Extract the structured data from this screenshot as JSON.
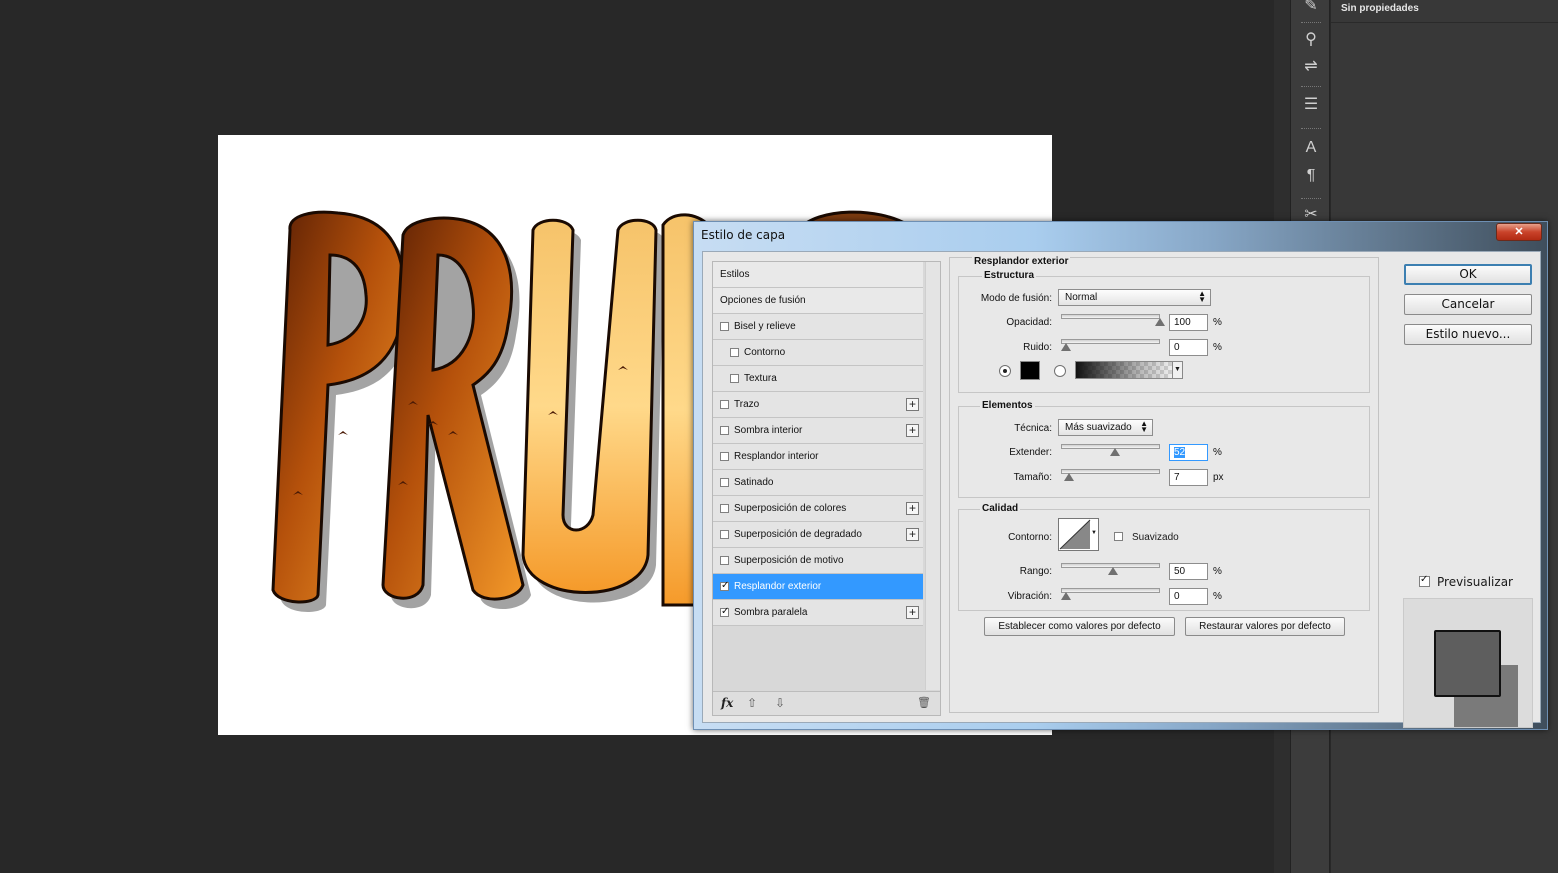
{
  "app": {
    "properties_panel_title": "Sin propiedades",
    "canvas_text": "PRUEBA"
  },
  "dialog": {
    "title": "Estilo de capa",
    "close_label": "✕",
    "styles_list": [
      {
        "label": "Estilos",
        "type": "header"
      },
      {
        "label": "Opciones de fusión",
        "type": "header"
      },
      {
        "label": "Bisel y relieve",
        "checked": false,
        "indent": false,
        "plus": false
      },
      {
        "label": "Contorno",
        "checked": false,
        "indent": true,
        "plus": false
      },
      {
        "label": "Textura",
        "checked": false,
        "indent": true,
        "plus": false
      },
      {
        "label": "Trazo",
        "checked": false,
        "indent": false,
        "plus": true
      },
      {
        "label": "Sombra interior",
        "checked": false,
        "indent": false,
        "plus": true
      },
      {
        "label": "Resplandor interior",
        "checked": false,
        "indent": false,
        "plus": false
      },
      {
        "label": "Satinado",
        "checked": false,
        "indent": false,
        "plus": false
      },
      {
        "label": "Superposición de colores",
        "checked": false,
        "indent": false,
        "plus": true
      },
      {
        "label": "Superposición de degradado",
        "checked": false,
        "indent": false,
        "plus": true
      },
      {
        "label": "Superposición de motivo",
        "checked": false,
        "indent": false,
        "plus": false
      },
      {
        "label": "Resplandor exterior",
        "checked": true,
        "indent": false,
        "plus": false,
        "selected": true
      },
      {
        "label": "Sombra paralela",
        "checked": true,
        "indent": false,
        "plus": true
      }
    ],
    "footer": {
      "fx": "fx",
      "up": "⇧",
      "down": "⇩",
      "trash": "🗑"
    },
    "panel_title": "Resplandor exterior",
    "estructura": {
      "title": "Estructura",
      "blend_mode_label": "Modo de fusión:",
      "blend_mode_value": "Normal",
      "opacity_label": "Opacidad:",
      "opacity_value": "100",
      "opacity_unit": "%",
      "opacity_level": 1.0,
      "noise_label": "Ruido:",
      "noise_value": "0",
      "noise_unit": "%",
      "noise_level": 0.0,
      "color_swatch": "#000000"
    },
    "elementos": {
      "title": "Elementos",
      "technique_label": "Técnica:",
      "technique_value": "Más suavizado",
      "spread_label": "Extender:",
      "spread_value": "52",
      "spread_unit": "%",
      "spread_level": 0.52,
      "size_label": "Tamaño:",
      "size_value": "7",
      "size_unit": "px",
      "size_level": 0.03
    },
    "calidad": {
      "title": "Calidad",
      "contour_label": "Contorno:",
      "antialias_label": "Suavizado",
      "antialias_checked": false,
      "range_label": "Rango:",
      "range_value": "50",
      "range_unit": "%",
      "range_level": 0.5,
      "jitter_label": "Vibración:",
      "jitter_value": "0",
      "jitter_unit": "%",
      "jitter_level": 0.0
    },
    "make_default_label": "Establecer como valores por defecto",
    "reset_default_label": "Restaurar valores por defecto",
    "ok_label": "OK",
    "cancel_label": "Cancelar",
    "new_style_label": "Estilo nuevo...",
    "preview_label": "Previsualizar",
    "preview_checked": true
  },
  "colors": {
    "selection": "#3399ff",
    "title_gradient_start": "#c7ddf3",
    "close_red": "#c9432a"
  }
}
